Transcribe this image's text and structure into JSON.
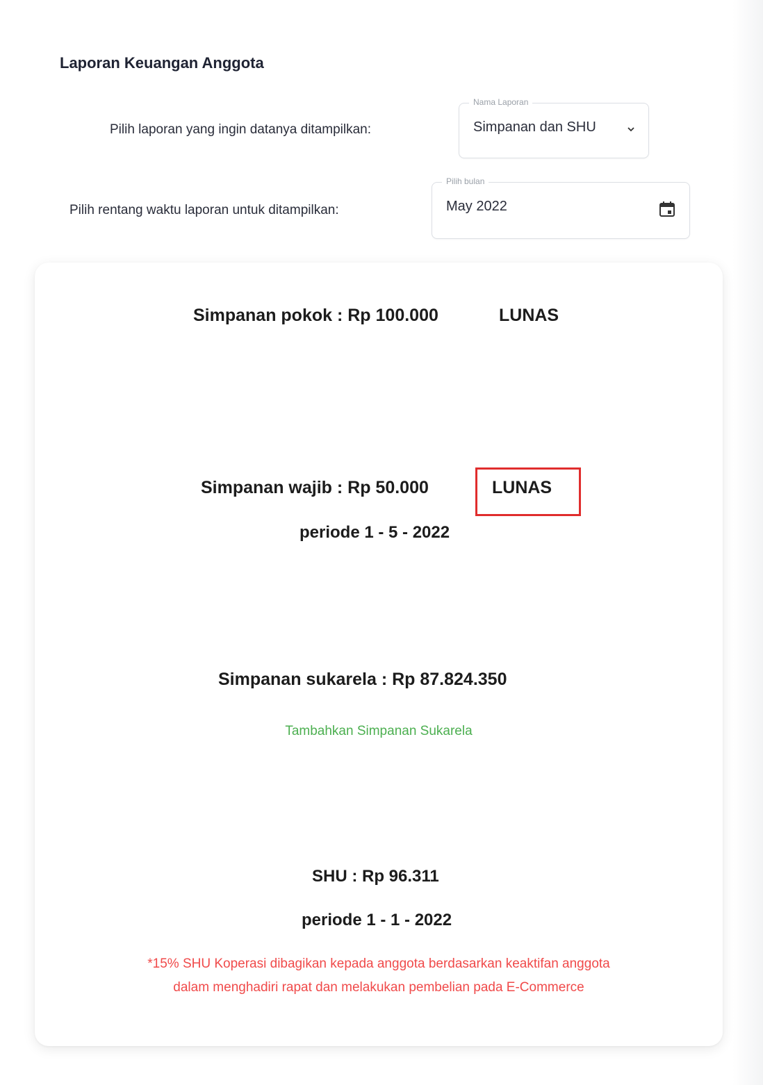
{
  "header": {
    "title": "Laporan Keuangan Anggota"
  },
  "filters": {
    "report_label": "Pilih laporan yang ingin datanya ditampilkan:",
    "report_legend": "Nama Laporan",
    "report_value": "Simpanan dan SHU",
    "period_label": "Pilih rentang waktu laporan untuk ditampilkan:",
    "period_legend": "Pilih bulan",
    "period_value": "May 2022"
  },
  "report": {
    "pokok_text": "Simpanan pokok : Rp 100.000",
    "pokok_status": "LUNAS",
    "wajib_text": "Simpanan wajib : Rp 50.000",
    "wajib_status": "LUNAS",
    "wajib_period": "periode 1 - 5 - 2022",
    "sukarela_text": "Simpanan sukarela : Rp 87.824.350",
    "sukarela_link": "Tambahkan Simpanan Sukarela",
    "shu_text": "SHU : Rp 96.311",
    "shu_period": "periode 1 - 1 - 2022",
    "shu_note_line1": "*15% SHU Koperasi dibagikan kepada anggota berdasarkan keaktifan anggota",
    "shu_note_line2": "dalam menghadiri rapat dan melakukan pembelian pada E-Commerce"
  },
  "colors": {
    "highlight_box": "#e02d2d",
    "link_green": "#4caf50",
    "note_red": "#f04a4a"
  },
  "icons": {
    "dropdown": "chevron-down-icon",
    "calendar": "calendar-icon"
  }
}
